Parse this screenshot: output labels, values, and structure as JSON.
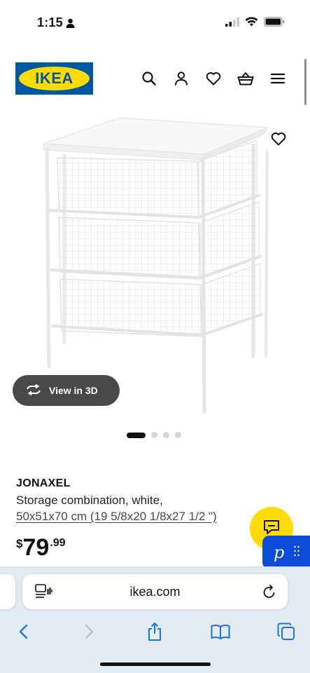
{
  "status_bar": {
    "time": "1:15"
  },
  "header": {
    "logo_text": "IKEA"
  },
  "product": {
    "name": "JONAXEL",
    "description": "Storage combination, white,",
    "size": "50x51x70 cm (19 5/8x20 1/8x27 1/2 \")",
    "price": {
      "currency": "$",
      "integer": "79",
      "decimal": ".99"
    }
  },
  "gallery": {
    "view_3d_label": "View in 3D",
    "image_count": 4,
    "active_image": 1
  },
  "widgets": {
    "p_label": "p"
  },
  "browser": {
    "url": "ikea.com"
  },
  "colors": {
    "ikea_blue": "#0058a3",
    "ikea_yellow": "#ffdb00",
    "safari_blue": "#1a73e8",
    "p_widget_blue": "#0c4ad8"
  }
}
